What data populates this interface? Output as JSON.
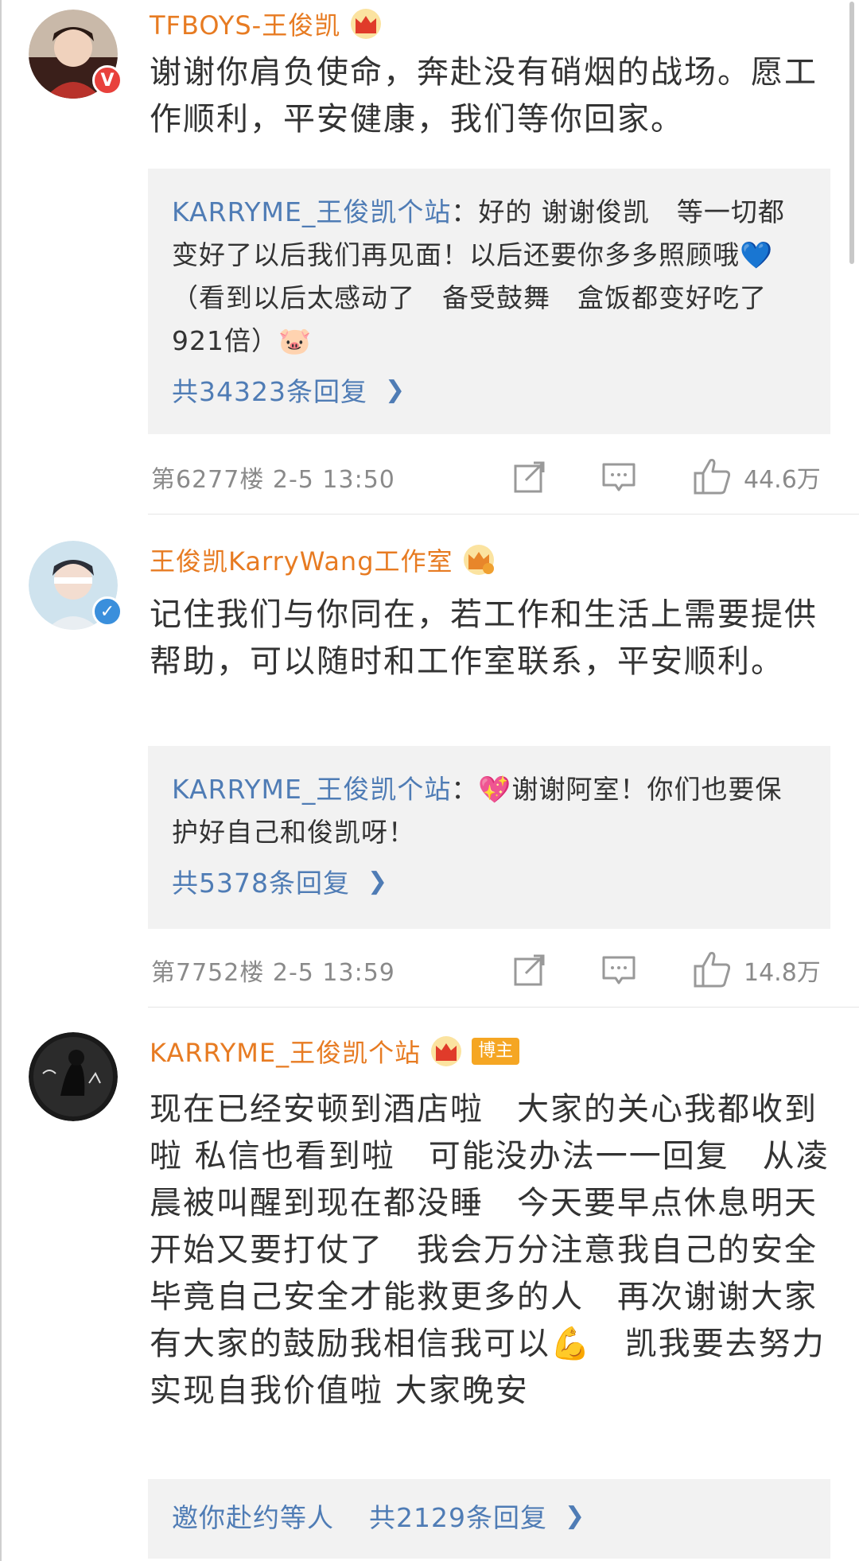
{
  "comments": [
    {
      "username": "TFBOYS-王俊凯",
      "text": "谢谢你肩负使命，奔赴没有硝烟的战场。愿工作顺利，平安健康，我们等你回家。",
      "reply_user": "KARRYME_王俊凯个站",
      "reply_text": "：好的 谢谢俊凯　等一切都变好了以后我们再见面！以后还要你多多照顾哦💙（看到以后太感动了　备受鼓舞　盒饭都变好吃了921倍）🐷",
      "reply_count": "共34323条回复",
      "floor_time": "第6277楼 2-5 13:50",
      "likes": "44.6万"
    },
    {
      "username": "王俊凯KarryWang工作室",
      "text": "记住我们与你同在，若工作和生活上需要提供帮助，可以随时和工作室联系，平安顺利。",
      "reply_user": "KARRYME_王俊凯个站",
      "reply_text": "：💖谢谢阿室！你们也要保护好自己和俊凯呀！",
      "reply_count": "共5378条回复",
      "floor_time": "第7752楼 2-5 13:59",
      "likes": "14.8万"
    },
    {
      "username": "KARRYME_王俊凯个站",
      "host_badge": "博主",
      "text": "现在已经安顿到酒店啦　大家的关心我都收到啦 私信也看到啦　可能没办法一一回复　从凌晨被叫醒到现在都没睡　今天要早点休息明天开始又要打仗了　我会万分注意我自己的安全　毕竟自己安全才能救更多的人　再次谢谢大家　有大家的鼓励我相信我可以💪　凯我要去努力实现自我价值啦 大家晚安",
      "reply_prefix": "邀你赴约等人",
      "reply_count": "共2129条回复"
    }
  ],
  "colors": {
    "accent": "#e77b22",
    "link": "#4f7cb5",
    "badge_red": "#e8413c",
    "badge_blue": "#3a8fdc",
    "host_badge": "#f5a623"
  },
  "icons": [
    "crown-icon",
    "verified-icon",
    "share-icon",
    "comment-icon",
    "like-icon",
    "chevron-right-icon"
  ]
}
